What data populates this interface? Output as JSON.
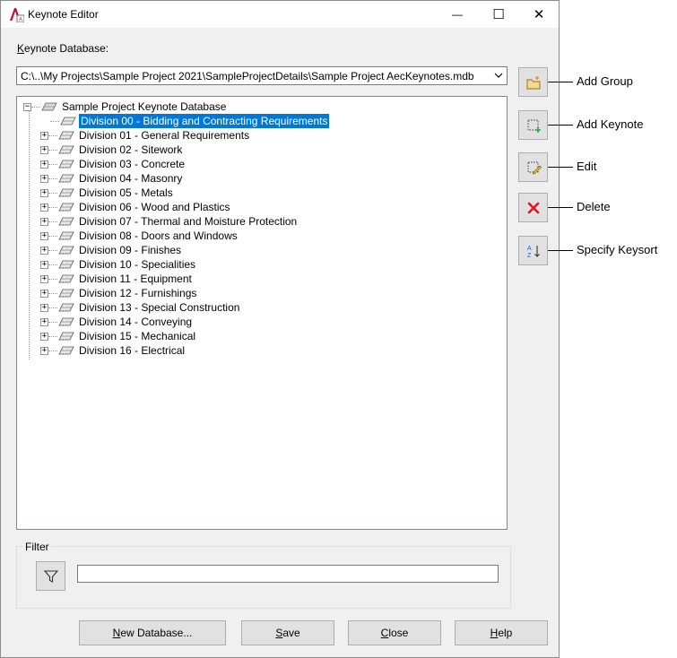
{
  "window": {
    "title": "Keynote Editor",
    "minimize_glyph": "—",
    "maximize_glyph": "☐",
    "close_glyph": "✕"
  },
  "database": {
    "label_accel": "K",
    "label_rest": "eynote Database:",
    "path": "C:\\..\\My Projects\\Sample Project 2021\\SampleProjectDetails\\Sample Project AecKeynotes.mdb"
  },
  "tree": {
    "root": "Sample Project Keynote Database",
    "items": [
      {
        "label": "Division 00 - Bidding and Contracting Requirements",
        "selected": true,
        "has_children": false
      },
      {
        "label": "Division 01 - General Requirements",
        "selected": false,
        "has_children": true
      },
      {
        "label": "Division 02 - Sitework",
        "selected": false,
        "has_children": true
      },
      {
        "label": "Division 03 - Concrete",
        "selected": false,
        "has_children": true
      },
      {
        "label": "Division 04 - Masonry",
        "selected": false,
        "has_children": true
      },
      {
        "label": "Division 05 - Metals",
        "selected": false,
        "has_children": true
      },
      {
        "label": "Division 06 - Wood and Plastics",
        "selected": false,
        "has_children": true
      },
      {
        "label": "Division 07 - Thermal and Moisture Protection",
        "selected": false,
        "has_children": true
      },
      {
        "label": "Division 08 - Doors and Windows",
        "selected": false,
        "has_children": true
      },
      {
        "label": "Division 09 - Finishes",
        "selected": false,
        "has_children": true
      },
      {
        "label": "Division 10 - Specialities",
        "selected": false,
        "has_children": true
      },
      {
        "label": "Division 11 - Equipment",
        "selected": false,
        "has_children": true
      },
      {
        "label": "Division 12 - Furnishings",
        "selected": false,
        "has_children": true
      },
      {
        "label": "Division 13 - Special Construction",
        "selected": false,
        "has_children": true
      },
      {
        "label": "Division 14 - Conveying",
        "selected": false,
        "has_children": true
      },
      {
        "label": "Division 15 - Mechanical",
        "selected": false,
        "has_children": true
      },
      {
        "label": "Division 16 - Electrical",
        "selected": false,
        "has_children": true
      }
    ]
  },
  "side_buttons": [
    {
      "icon": "add-group-icon",
      "callout": "Add Group"
    },
    {
      "icon": "add-keynote-icon",
      "callout": "Add Keynote"
    },
    {
      "icon": "edit-icon",
      "callout": "Edit"
    },
    {
      "icon": "delete-icon",
      "callout": "Delete"
    },
    {
      "icon": "specify-keysort-icon",
      "callout": "Specify Keysort"
    }
  ],
  "filter": {
    "legend": "Filter",
    "icon": "funnel-icon",
    "value": ""
  },
  "buttons": {
    "new_database": {
      "accel": "N",
      "rest": "ew Database..."
    },
    "save": {
      "accel": "S",
      "rest": "ave"
    },
    "close": {
      "accel": "C",
      "rest": "lose"
    },
    "help": {
      "accel": "H",
      "rest": "elp"
    }
  },
  "colors": {
    "selection": "#0078d7",
    "dialog_bg": "#f0f0f0",
    "button_bg": "#e1e1e1",
    "delete_red": "#e81123",
    "add_green": "#2e9e3e"
  }
}
